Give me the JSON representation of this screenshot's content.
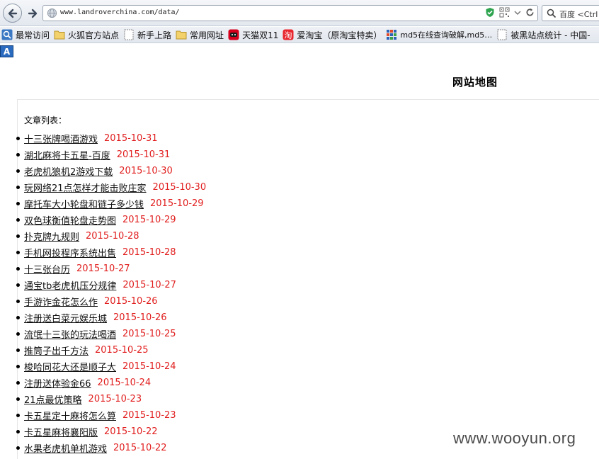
{
  "browser": {
    "url": "www.landroverchina.com/data/",
    "search_text": "百度 <Ctrl"
  },
  "bookmarks": [
    {
      "label": "最常访问",
      "icon": "magnifier-bookmark-icon"
    },
    {
      "label": "火狐官方站点",
      "icon": "folder-icon"
    },
    {
      "label": "新手上路",
      "icon": "blank-page-icon"
    },
    {
      "label": "常用网址",
      "icon": "folder-icon"
    },
    {
      "label": "天猫双11",
      "icon": "tmall-icon"
    },
    {
      "label": "爱淘宝（原淘宝特卖）",
      "icon": "taobao-icon"
    },
    {
      "label": "md5在线查询破解,md5…",
      "icon": "md5-site-icon"
    },
    {
      "label": "被黑站点统计 - 中国-",
      "icon": "blank-page-icon"
    }
  ],
  "extension_icon_label": "A",
  "page": {
    "title": "网站地图",
    "list_heading": "文章列表：",
    "articles": [
      {
        "title": "十三张牌喝酒游戏",
        "date": "2015-10-31"
      },
      {
        "title": "湖北麻将卡五星-百度",
        "date": "2015-10-31"
      },
      {
        "title": "老虎机狼机2游戏下载",
        "date": "2015-10-30"
      },
      {
        "title": "玩网络21点怎样才能击败庄家",
        "date": "2015-10-30"
      },
      {
        "title": "摩托车大小轮盘和链子多少钱",
        "date": "2015-10-29"
      },
      {
        "title": "双色球衡值轮盘走势图",
        "date": "2015-10-29"
      },
      {
        "title": "扑克牌九规则",
        "date": "2015-10-28"
      },
      {
        "title": "手机网投程序系统出售",
        "date": "2015-10-28"
      },
      {
        "title": "十三张台历",
        "date": "2015-10-27"
      },
      {
        "title": "通宝tb老虎机压分规律",
        "date": "2015-10-27"
      },
      {
        "title": "手游诈金花怎么作",
        "date": "2015-10-26"
      },
      {
        "title": "注册送白菜元娱乐城",
        "date": "2015-10-26"
      },
      {
        "title": "流氓十三张的玩法喝酒",
        "date": "2015-10-25"
      },
      {
        "title": "推筒子出千方法",
        "date": "2015-10-25"
      },
      {
        "title": "梭哈同花大还是顺子大",
        "date": "2015-10-24"
      },
      {
        "title": "注册送体验金66",
        "date": "2015-10-24"
      },
      {
        "title": "21点最优策略",
        "date": "2015-10-23"
      },
      {
        "title": "卡五星定十麻将怎么算",
        "date": "2015-10-23"
      },
      {
        "title": "卡五星麻将襄阳版",
        "date": "2015-10-22"
      },
      {
        "title": "水果老虎机单机游戏",
        "date": "2015-10-22"
      }
    ]
  },
  "watermark": "www.wooyun.org",
  "colors": {
    "date_red": "#e11d1d",
    "shield_green": "#2ea44f"
  }
}
